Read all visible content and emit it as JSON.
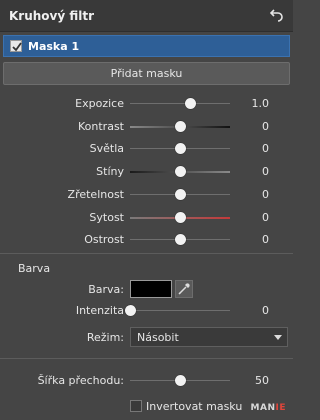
{
  "header": {
    "title": "Kruhový filtr",
    "undo_icon": "undo-arrow-icon"
  },
  "mask": {
    "label": "Maska 1",
    "checked": true
  },
  "add_mask_label": "Přidat masku",
  "sliders": [
    {
      "label": "Expozice",
      "value": "1.0",
      "position": 0.6,
      "track": "plain"
    },
    {
      "label": "Kontrast",
      "value": "0",
      "position": 0.5,
      "track": "contrast"
    },
    {
      "label": "Světla",
      "value": "0",
      "position": 0.5,
      "track": "plain"
    },
    {
      "label": "Stíny",
      "value": "0",
      "position": 0.5,
      "track": "shadows"
    },
    {
      "label": "Zřetelnost",
      "value": "0",
      "position": 0.5,
      "track": "plain"
    },
    {
      "label": "Sytost",
      "value": "0",
      "position": 0.5,
      "track": "saturation"
    },
    {
      "label": "Ostrost",
      "value": "0",
      "position": 0.5,
      "track": "plain"
    }
  ],
  "color_section": {
    "title": "Barva",
    "color_label": "Barva:",
    "color_value": "#000000",
    "picker_icon": "eyedropper-icon",
    "intensity_label": "Intenzita",
    "intensity_value": "0",
    "intensity_position": 0.0,
    "mode_label": "Režim:",
    "mode_value": "Násobit"
  },
  "feather": {
    "label": "Šířka přechodu:",
    "value": "50",
    "position": 0.5
  },
  "invert": {
    "label": "Invertovat masku",
    "checked": false
  },
  "watermark": {
    "main": "MAN",
    "accent": "IE"
  },
  "colors": {
    "panel": "#454545",
    "header": "#393939",
    "selected": "#2e5f97",
    "accent_red": "#c43a3a"
  }
}
